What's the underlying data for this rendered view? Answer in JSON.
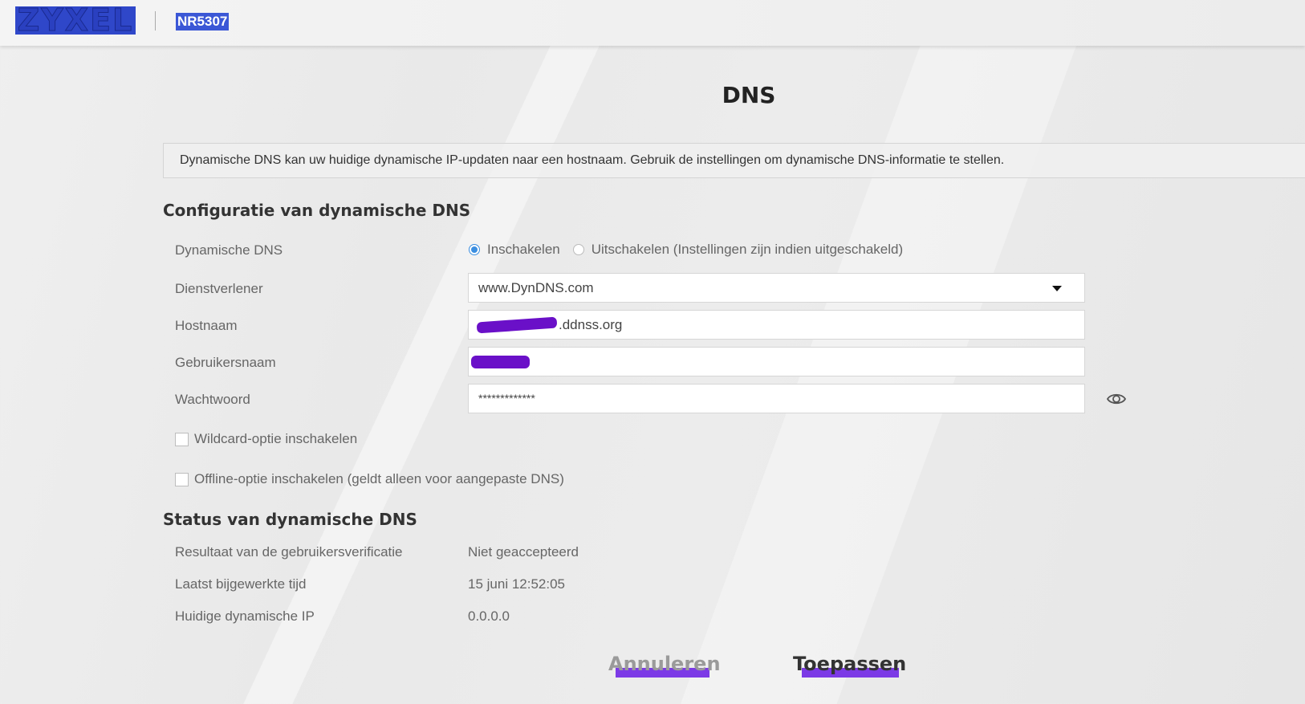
{
  "header": {
    "logo_text": "ZYXEL",
    "model": "NR5307"
  },
  "page": {
    "title": "DNS",
    "info": "Dynamische DNS kan uw huidige dynamische IP-updaten naar een hostnaam. Gebruik de instellingen om dynamische DNS-informatie te stellen."
  },
  "config": {
    "section_title": "Configuratie van dynamische DNS",
    "ddns_label": "Dynamische DNS",
    "enable_label": "Inschakelen",
    "disable_label": "Uitschakelen (Instellingen zijn indien uitgeschakeld)",
    "ddns_enabled": true,
    "provider_label": "Dienstverlener",
    "provider_value": "www.DynDNS.com",
    "hostname_label": "Hostnaam",
    "hostname_suffix": ".ddnss.org",
    "username_label": "Gebruikersnaam",
    "password_label": "Wachtwoord",
    "password_value": "*************",
    "wildcard_label": "Wildcard-optie inschakelen",
    "wildcard_checked": false,
    "offline_label": "Offline-optie inschakelen (geldt alleen voor aangepaste DNS)",
    "offline_checked": false
  },
  "status": {
    "section_title": "Status van dynamische DNS",
    "rows": [
      {
        "label": "Resultaat van de gebruikersverificatie",
        "value": "Niet geaccepteerd"
      },
      {
        "label": "Laatst bijgewerkte tijd",
        "value": "15 juni 12:52:05"
      },
      {
        "label": "Huidige dynamische IP",
        "value": "0.0.0.0"
      }
    ]
  },
  "actions": {
    "cancel_label": "Annuleren",
    "apply_label": "Toepassen"
  },
  "colors": {
    "logo_blue": "#2f47c9",
    "radio_accent": "#3b8ee0",
    "redaction": "#6a10c8"
  }
}
